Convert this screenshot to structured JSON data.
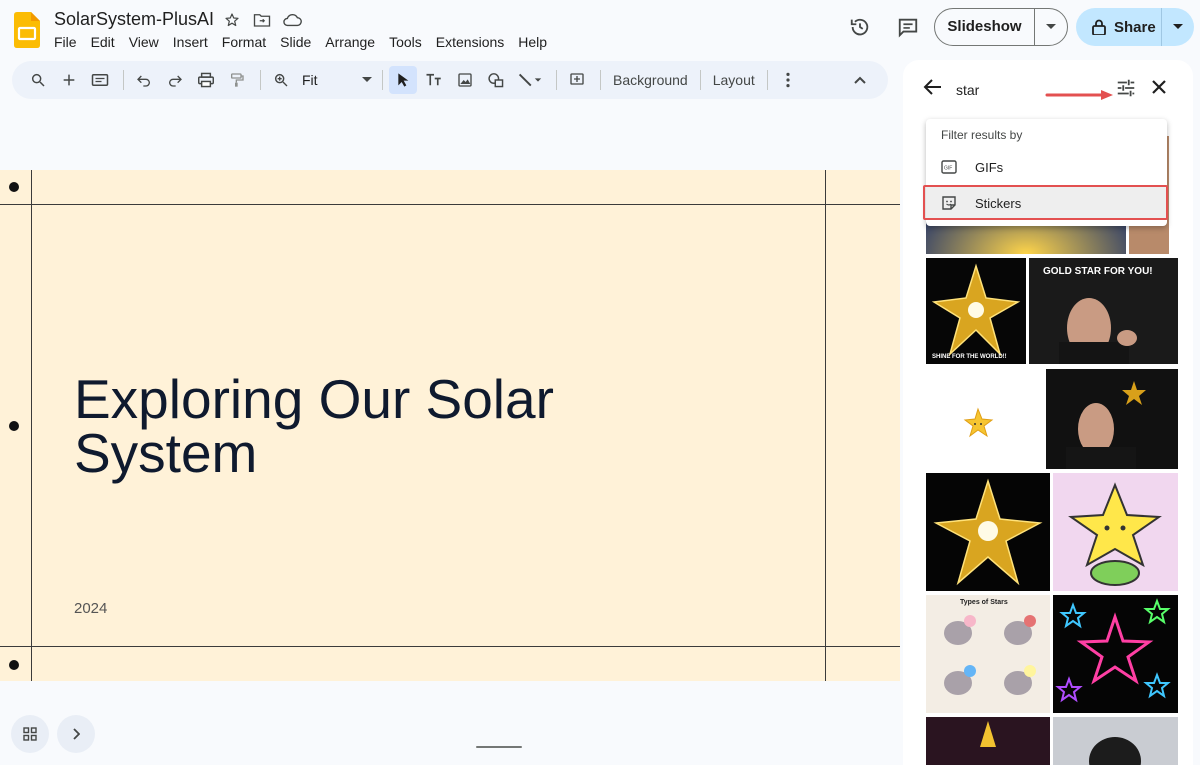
{
  "header": {
    "doc_title": "SolarSystem-PlusAI",
    "menu": [
      "File",
      "Edit",
      "View",
      "Insert",
      "Format",
      "Slide",
      "Arrange",
      "Tools",
      "Extensions",
      "Help"
    ],
    "slideshow_label": "Slideshow",
    "share_label": "Share"
  },
  "toolbar": {
    "zoom_value": "Fit",
    "background_label": "Background",
    "layout_label": "Layout"
  },
  "slide": {
    "title": "Exploring Our Solar System",
    "year": "2024"
  },
  "panel": {
    "query": "star",
    "filter_menu": {
      "heading": "Filter results by",
      "items": [
        {
          "label": "GIFs",
          "icon": "gif-icon"
        },
        {
          "label": "Stickers",
          "icon": "sticker-icon",
          "highlighted": true
        }
      ]
    },
    "results": [
      {
        "caption": "SHINE FOR THE WORLD!!"
      },
      {
        "caption": "GOLD STAR FOR YOU!"
      },
      {
        "caption": "Types of Stars"
      }
    ]
  },
  "colors": {
    "slide_background": "#fff2d8",
    "accent_blue": "#c2e7ff",
    "highlight_red": "#e35050"
  }
}
